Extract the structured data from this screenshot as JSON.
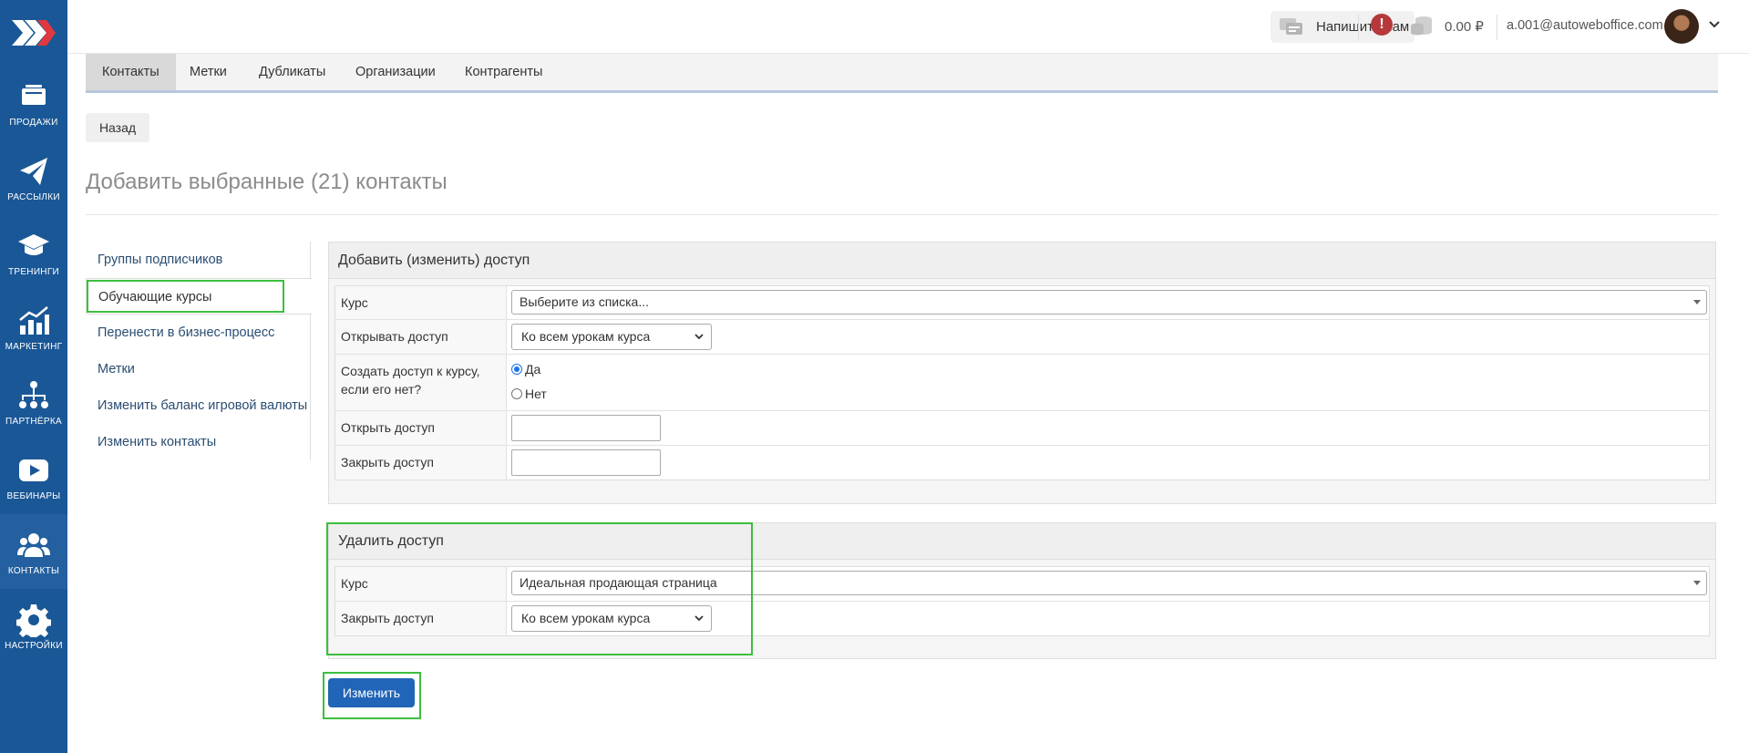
{
  "sidebar": {
    "items": [
      {
        "label": "ПРОДАЖИ",
        "icon": "cart-icon"
      },
      {
        "label": "РАССЫЛКИ",
        "icon": "paper-plane-icon"
      },
      {
        "label": "ТРЕНИНГИ",
        "icon": "graduation-cap-icon"
      },
      {
        "label": "МАРКЕТИНГ",
        "icon": "chart-icon"
      },
      {
        "label": "ПАРТНЁРКА",
        "icon": "network-icon"
      },
      {
        "label": "ВЕБИНАРЫ",
        "icon": "play-icon"
      },
      {
        "label": "КОНТАКТЫ",
        "icon": "users-icon"
      },
      {
        "label": "НАСТРОЙКИ",
        "icon": "gear-icon"
      }
    ],
    "active": "КОНТАКТЫ"
  },
  "topbar": {
    "write_label": "Напишите нам",
    "balance": "0.00 ₽",
    "email": "a.001@autoweboffice.com"
  },
  "tabs": [
    "Контакты",
    "Метки",
    "Дубликаты",
    "Организации",
    "Контрагенты"
  ],
  "back_label": "Назад",
  "page_title": "Добавить выбранные (21) контакты",
  "left_menu": [
    "Группы подписчиков",
    "Обучающие курсы",
    "Перенести в бизнес-процесс",
    "Метки",
    "Изменить баланс игровой валюты",
    "Изменить контакты"
  ],
  "add_panel": {
    "title": "Добавить (изменить) доступ",
    "course_label": "Курс",
    "course_value": "Выберите из списка...",
    "open_access_label": "Открывать доступ",
    "open_access_value": "Ко всем урокам курса",
    "create_label": "Создать доступ к курсу, если его нет?",
    "yes_label": "Да",
    "no_label": "Нет",
    "open_date_label": "Открыть доступ",
    "close_date_label": "Закрыть доступ"
  },
  "remove_panel": {
    "title": "Удалить доступ",
    "course_label": "Курс",
    "course_value": "Идеальная продающая страница",
    "close_label": "Закрыть доступ",
    "close_value": "Ко всем урокам курса"
  },
  "submit_label": "Изменить",
  "colors": {
    "sidebar": "#1a5796",
    "primary_button": "#2165b8",
    "highlight": "#3dbf3d"
  }
}
